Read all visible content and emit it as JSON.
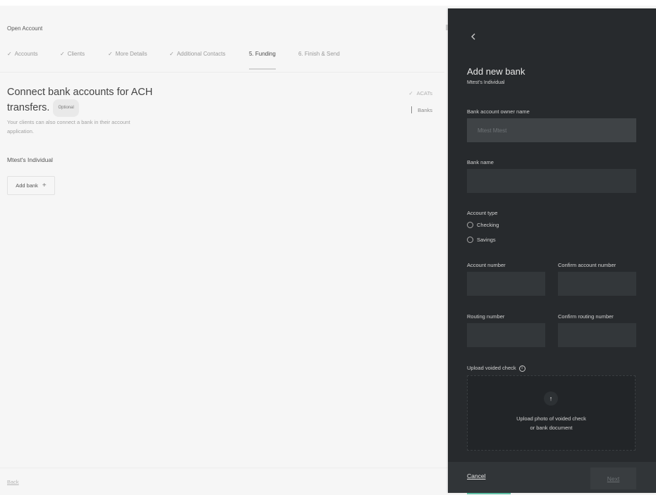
{
  "app": {
    "title": "Open Account"
  },
  "steps": [
    {
      "label": "Accounts",
      "completed": true,
      "active": false
    },
    {
      "label": "Clients",
      "completed": true,
      "active": false
    },
    {
      "label": "More Details",
      "completed": true,
      "active": false
    },
    {
      "label": "Additional Contacts",
      "completed": true,
      "active": false
    },
    {
      "label": "5. Funding",
      "completed": false,
      "active": true
    },
    {
      "label": "6. Finish & Send",
      "completed": false,
      "active": false
    }
  ],
  "main": {
    "heading_line1": "Connect bank accounts for ACH",
    "heading_line2": "transfers.",
    "optional_badge": "Optional",
    "subtext": "Your clients can also connect a bank in their account application.",
    "account_label": "Mtest's Individual",
    "add_bank_label": "Add bank",
    "add_bank_icon": "plus-icon",
    "back_label": "Back"
  },
  "subnav": [
    {
      "label": "ACATs",
      "completed": true,
      "active": false
    },
    {
      "label": "Banks",
      "completed": false,
      "active": true
    }
  ],
  "drawer": {
    "title": "Add new bank",
    "subtitle": "Mtest's Individual",
    "back_icon": "chevron-left-icon",
    "fields": {
      "owner_name": {
        "label": "Bank account owner name",
        "value": "Mtest Mtest",
        "disabled": true
      },
      "bank_name": {
        "label": "Bank name",
        "value": ""
      },
      "account_type": {
        "label": "Account type",
        "options": [
          "Checking",
          "Savings"
        ],
        "selected": null
      },
      "account_number": {
        "label": "Account number",
        "value": ""
      },
      "confirm_account_number": {
        "label": "Confirm account number",
        "value": ""
      },
      "routing_number": {
        "label": "Routing number",
        "value": ""
      },
      "confirm_routing_number": {
        "label": "Confirm routing number",
        "value": ""
      }
    },
    "upload": {
      "label": "Upload voided check",
      "info_icon": "info-icon",
      "icon": "arrow-up-icon",
      "text_line1": "Upload photo of voided check",
      "text_line2": "or bank document"
    },
    "footer": {
      "cancel_label": "Cancel",
      "next_label": "Next",
      "next_disabled": true
    }
  },
  "colors": {
    "drawer_bg": "#272a2d",
    "input_bg": "#33373a",
    "page_bg": "#f6f6f6",
    "focus_accent": "#5fc1a6"
  }
}
